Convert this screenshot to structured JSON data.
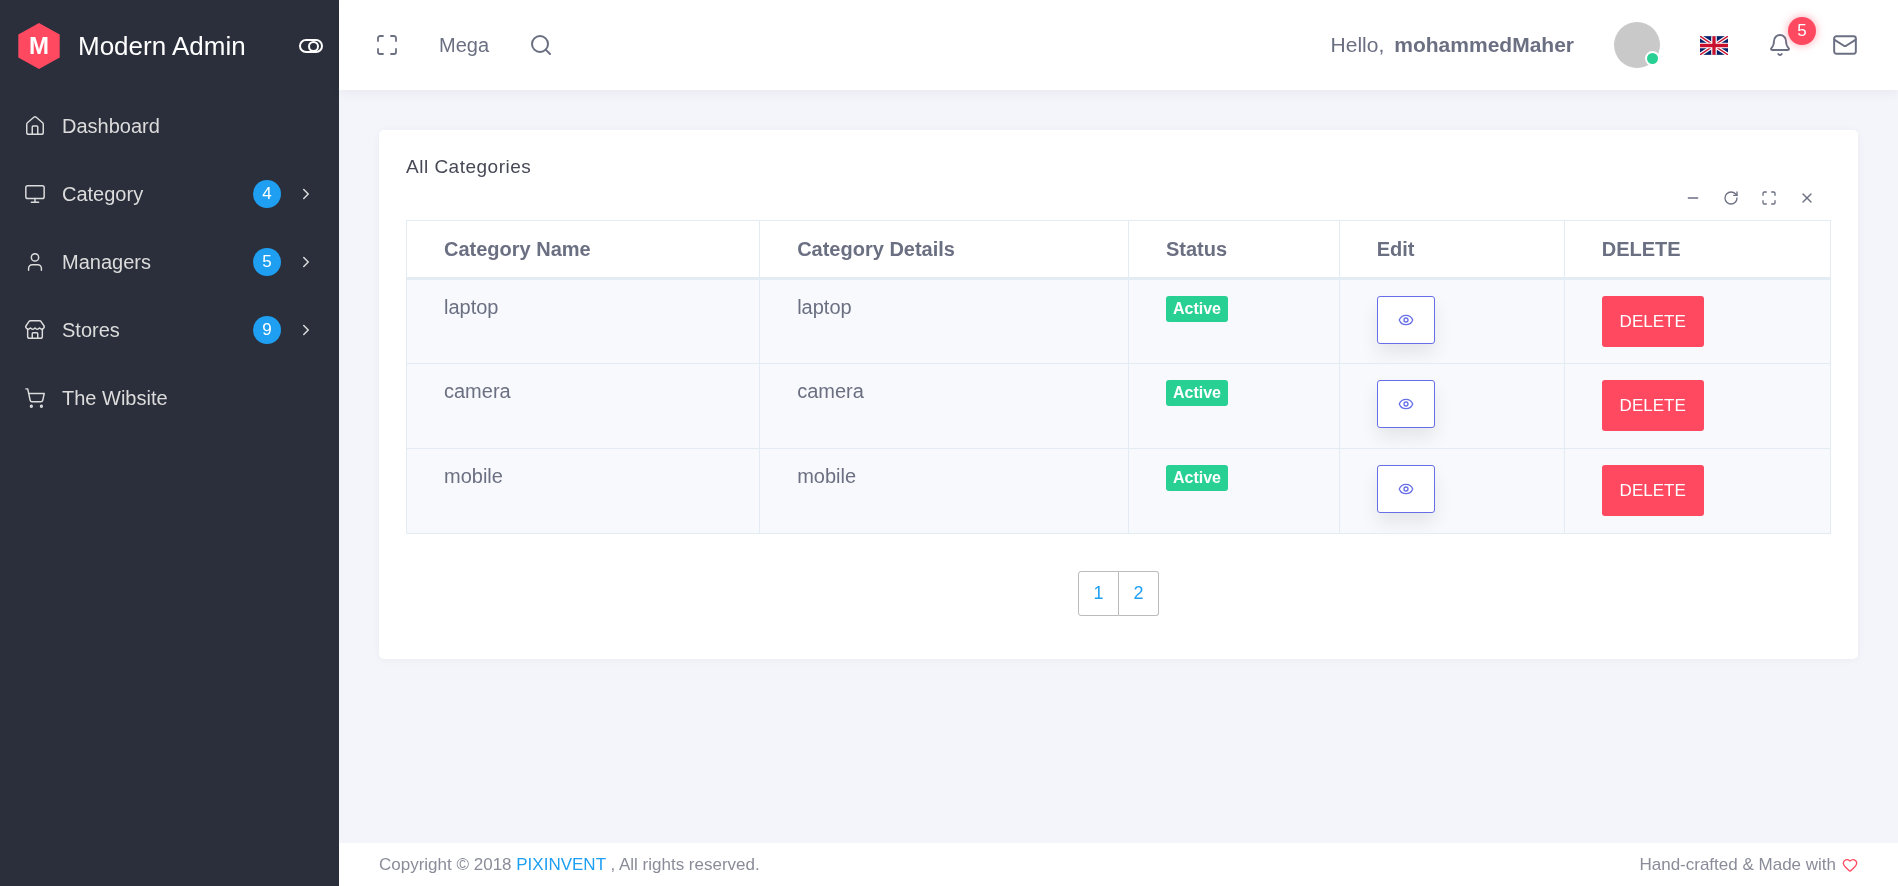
{
  "brand": {
    "logo_letter": "M",
    "title": "Modern Admin"
  },
  "sidebar": {
    "items": [
      {
        "label": "Dashboard"
      },
      {
        "label": "Category",
        "badge": "4"
      },
      {
        "label": "Managers",
        "badge": "5"
      },
      {
        "label": "Stores",
        "badge": "9"
      },
      {
        "label": "The Wibsite"
      }
    ]
  },
  "header": {
    "mega": "Mega",
    "greeting": "Hello,",
    "user": "mohammedMaher",
    "notifications": "5"
  },
  "card": {
    "title": "All Categories",
    "table": {
      "columns": [
        "Category Name",
        "Category Details",
        "Status",
        "Edit",
        "DELETE"
      ],
      "rows": [
        {
          "name": "laptop",
          "details": "laptop",
          "status": "Active",
          "delete": "DELETE"
        },
        {
          "name": "camera",
          "details": "camera",
          "status": "Active",
          "delete": "DELETE"
        },
        {
          "name": "mobile",
          "details": "mobile",
          "status": "Active",
          "delete": "DELETE"
        }
      ]
    },
    "pages": [
      "1",
      "2"
    ]
  },
  "footer": {
    "copyright_before": "Copyright © 2018",
    "link": "PIXINVENT",
    "copyright_after": ", All rights reserved.",
    "credit": "Hand-crafted & Made with"
  }
}
